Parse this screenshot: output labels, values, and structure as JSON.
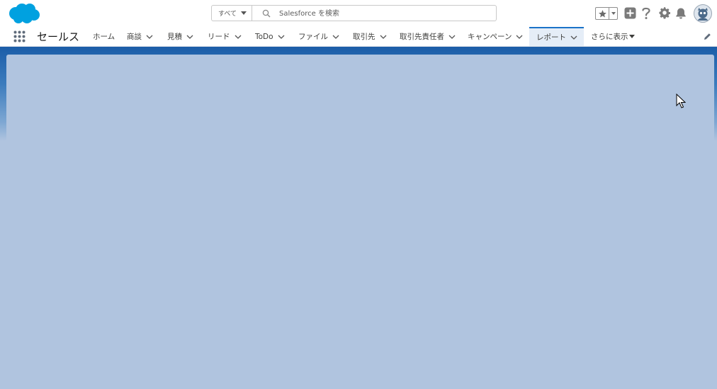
{
  "header": {
    "search_scope": "すべて",
    "search_placeholder": "Salesforce を検索"
  },
  "nav": {
    "app_name": "セールス",
    "tabs": [
      {
        "label": "ホーム"
      },
      {
        "label": "商談"
      },
      {
        "label": "見積"
      },
      {
        "label": "リード"
      },
      {
        "label": "ToDo"
      },
      {
        "label": "ファイル"
      },
      {
        "label": "取引先"
      },
      {
        "label": "取引先責任者"
      },
      {
        "label": "キャンペーン"
      },
      {
        "label": "レポート"
      }
    ],
    "more_label": "さらに表示",
    "active_tab": "レポート"
  },
  "colors": {
    "brand_blue": "#00a1e0",
    "active_tab_border": "#1b73c8",
    "active_tab_bg": "#e5edf7",
    "band_blue": "#1b5da8",
    "content_bg": "#b0c4df"
  },
  "icons": [
    "salesforce-cloud-logo",
    "search-icon",
    "favorites-star-icon",
    "add-icon",
    "help-icon",
    "settings-gear-icon",
    "notification-bell-icon",
    "user-avatar",
    "app-launcher-icon",
    "chevron-down-icon",
    "edit-pencil-icon",
    "mouse-cursor"
  ]
}
